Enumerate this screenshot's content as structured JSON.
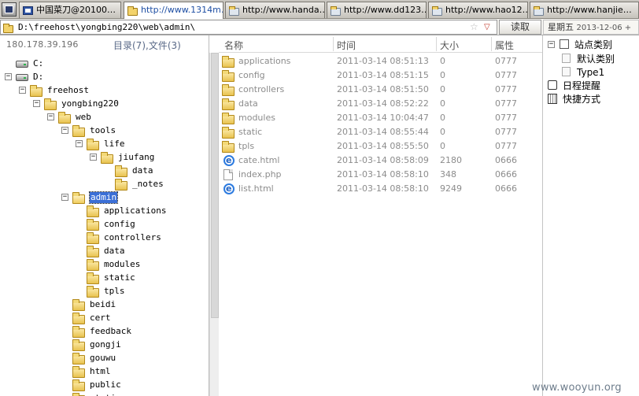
{
  "tabs": [
    {
      "label": "中国菜刀@20100…",
      "icon": "window-icon",
      "active": false
    },
    {
      "label": "http://www.1314m…",
      "icon": "folder-icon",
      "active": true
    },
    {
      "label": "http://www.handa…",
      "icon": "folder-icon",
      "active": false
    },
    {
      "label": "http://www.dd123…",
      "icon": "folder-icon",
      "active": false
    },
    {
      "label": "http://www.hao12…",
      "icon": "folder-icon",
      "active": false
    },
    {
      "label": "http://www.hanjie…",
      "icon": "folder-icon",
      "active": false
    }
  ],
  "address": {
    "path": "D:\\freehost\\yongbing220\\web\\admin\\",
    "star": "☆",
    "dropdown": "▽"
  },
  "read_button": "读取",
  "date_info": {
    "weekday": "星期五",
    "date": "2013-12-06 +"
  },
  "left": {
    "ip": "180.178.39.196",
    "summary": "目录(7),文件(3)",
    "tree": [
      {
        "label": "C:",
        "type": "drive",
        "toggle": ""
      },
      {
        "label": "D:",
        "type": "drive",
        "toggle": "−"
      },
      {
        "label": "freehost",
        "type": "folder",
        "toggle": "−"
      },
      {
        "label": "yongbing220",
        "type": "folder",
        "toggle": "−"
      },
      {
        "label": "web",
        "type": "folder",
        "toggle": "−"
      },
      {
        "label": "tools",
        "type": "folder",
        "toggle": "−"
      },
      {
        "label": "life",
        "type": "folder",
        "toggle": "−"
      },
      {
        "label": "jiufang",
        "type": "folder",
        "toggle": "−"
      },
      {
        "label": "data",
        "type": "folder",
        "toggle": ""
      },
      {
        "label": "_notes",
        "type": "folder",
        "toggle": ""
      },
      {
        "label": "admin",
        "type": "folder-open",
        "toggle": "−",
        "selected": true
      },
      {
        "label": "applications",
        "type": "folder",
        "toggle": ""
      },
      {
        "label": "config",
        "type": "folder",
        "toggle": ""
      },
      {
        "label": "controllers",
        "type": "folder",
        "toggle": ""
      },
      {
        "label": "data",
        "type": "folder",
        "toggle": ""
      },
      {
        "label": "modules",
        "type": "folder",
        "toggle": ""
      },
      {
        "label": "static",
        "type": "folder",
        "toggle": ""
      },
      {
        "label": "tpls",
        "type": "folder",
        "toggle": ""
      },
      {
        "label": "beidi",
        "type": "folder",
        "toggle": ""
      },
      {
        "label": "cert",
        "type": "folder",
        "toggle": ""
      },
      {
        "label": "feedback",
        "type": "folder",
        "toggle": ""
      },
      {
        "label": "gongji",
        "type": "folder",
        "toggle": ""
      },
      {
        "label": "gouwu",
        "type": "folder",
        "toggle": ""
      },
      {
        "label": "html",
        "type": "folder",
        "toggle": ""
      },
      {
        "label": "public",
        "type": "folder",
        "toggle": ""
      },
      {
        "label": "static",
        "type": "folder",
        "toggle": ""
      }
    ]
  },
  "list": {
    "columns": [
      "名称",
      "时间",
      "大小",
      "属性"
    ],
    "rows": [
      {
        "name": "applications",
        "icon": "folder-icon",
        "time": "2011-03-14 08:51:13",
        "size": "0",
        "attr": "0777"
      },
      {
        "name": "config",
        "icon": "folder-icon",
        "time": "2011-03-14 08:51:15",
        "size": "0",
        "attr": "0777"
      },
      {
        "name": "controllers",
        "icon": "folder-icon",
        "time": "2011-03-14 08:51:50",
        "size": "0",
        "attr": "0777"
      },
      {
        "name": "data",
        "icon": "folder-icon",
        "time": "2011-03-14 08:52:22",
        "size": "0",
        "attr": "0777"
      },
      {
        "name": "modules",
        "icon": "folder-icon",
        "time": "2011-03-14 10:04:47",
        "size": "0",
        "attr": "0777"
      },
      {
        "name": "static",
        "icon": "folder-icon",
        "time": "2011-03-14 08:55:44",
        "size": "0",
        "attr": "0777"
      },
      {
        "name": "tpls",
        "icon": "folder-icon",
        "time": "2011-03-14 08:55:50",
        "size": "0",
        "attr": "0777"
      },
      {
        "name": "cate.html",
        "icon": "html-file-icon",
        "time": "2011-03-14 08:58:09",
        "size": "2180",
        "attr": "0666"
      },
      {
        "name": "index.php",
        "icon": "php-file-icon",
        "time": "2011-03-14 08:58:10",
        "size": "348",
        "attr": "0666"
      },
      {
        "name": "list.html",
        "icon": "html-file-icon",
        "time": "2011-03-14 08:58:10",
        "size": "9249",
        "attr": "0666"
      }
    ]
  },
  "right": {
    "items": [
      {
        "label": "站点类别",
        "icon": "site-category-icon",
        "toggle": "−"
      },
      {
        "label": "默认类别",
        "icon": "document-icon",
        "toggle": ""
      },
      {
        "label": "Type1",
        "icon": "document-icon",
        "toggle": ""
      },
      {
        "label": "日程提醒",
        "icon": "calendar-icon",
        "toggle": ""
      },
      {
        "label": "快捷方式",
        "icon": "book-icon",
        "toggle": ""
      }
    ]
  },
  "watermark": "www.wooyun.org"
}
